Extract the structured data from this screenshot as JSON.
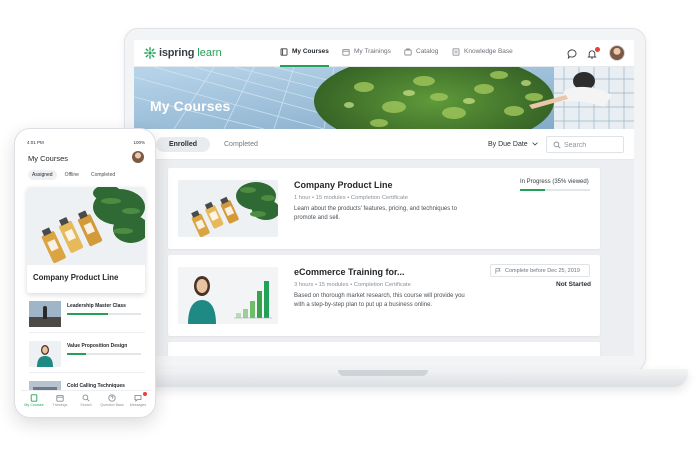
{
  "desktop": {
    "logo": {
      "part1": "ispring",
      "part2": "learn"
    },
    "nav": [
      {
        "label": "My Courses",
        "icon": "book-icon",
        "active": true
      },
      {
        "label": "My Trainings",
        "icon": "calendar-icon",
        "active": false
      },
      {
        "label": "Catalog",
        "icon": "catalog-icon",
        "active": false
      },
      {
        "label": "Knowledge Base",
        "icon": "knowledge-base-icon",
        "active": false
      }
    ],
    "banner_title": "My Courses",
    "tabs": {
      "enrolled": "Enrolled",
      "completed": "Completed"
    },
    "sort_label": "By Due Date",
    "search_placeholder": "Search",
    "courses": [
      {
        "title": "Company Product Line",
        "meta": "1 hour  •  15 modules  •  Completion Certificate",
        "description": "Learn about the products' features, pricing, and techniques to promote and sell.",
        "status": "In Progress (35% viewed)",
        "progress": 0.35
      },
      {
        "title": "eCommerce Training for...",
        "meta": "3 hours  •  15 modules  •  Completion Certificate",
        "description": "Based on thorough market research, this course will provide you with a step-by-step plan to put up a business online.",
        "due": "Complete before Dec 25, 2019",
        "status": "Not Started"
      }
    ]
  },
  "mobile": {
    "status_time": "4:01 PM",
    "status_right": "100%",
    "title": "My Courses",
    "tabs": [
      "Assigned",
      "Offline",
      "Completed"
    ],
    "featured_title": "Company Product Line",
    "items": [
      {
        "title": "Leadership Master Class",
        "progress": 0.55
      },
      {
        "title": "Value Proposition Design",
        "progress": 0.25
      },
      {
        "title": "Cold Calling Techniques",
        "progress": 0.0
      }
    ],
    "bottom_nav": [
      "My Courses",
      "Trainings",
      "Search",
      "Question Base",
      "Messages"
    ]
  },
  "colors": {
    "accent": "#23a15a",
    "badge": "#e5403a"
  }
}
